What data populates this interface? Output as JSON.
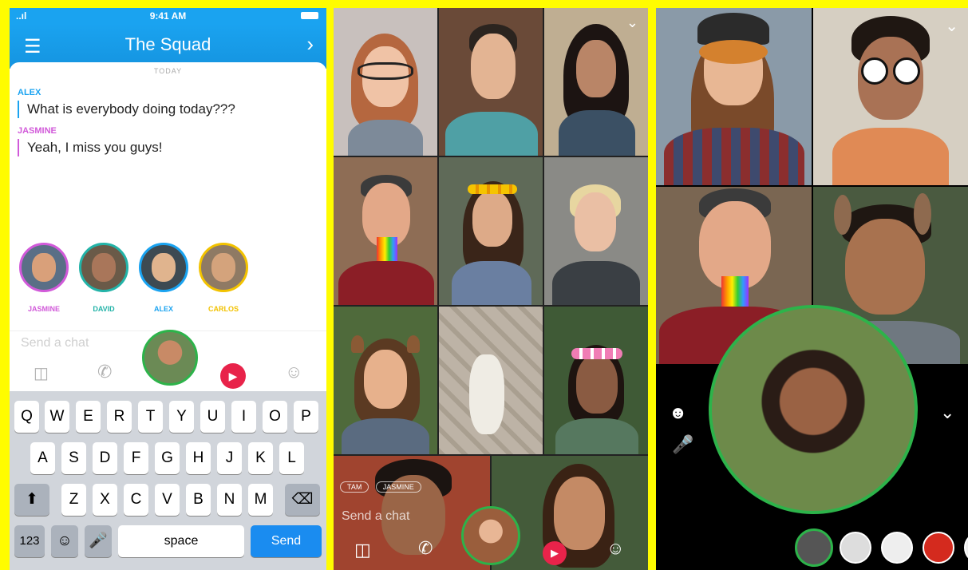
{
  "status_bar": {
    "signal": "..ıl",
    "time": "9:41 AM"
  },
  "chat_header": {
    "title": "The Squad",
    "menu_icon": "hamburger-icon",
    "forward_icon": "chevron-right-icon"
  },
  "chat": {
    "date_label": "TODAY",
    "messages": [
      {
        "author": "ALEX",
        "text": "What is everybody doing today???",
        "color": "#1aa3f0"
      },
      {
        "author": "JASMINE",
        "text": "Yeah, I miss you guys!",
        "color": "#d15ad9"
      }
    ]
  },
  "participants": [
    {
      "name": "JASMINE",
      "color": "#d15ad9"
    },
    {
      "name": "DAVID",
      "color": "#23b3a8"
    },
    {
      "name": "ALEX",
      "color": "#1aa3f0"
    },
    {
      "name": "CARLOS",
      "color": "#f2c200"
    }
  ],
  "composer": {
    "placeholder": "Send a chat"
  },
  "keyboard": {
    "row1": [
      "Q",
      "W",
      "E",
      "R",
      "T",
      "Y",
      "U",
      "I",
      "O",
      "P"
    ],
    "row2": [
      "A",
      "S",
      "D",
      "F",
      "G",
      "H",
      "J",
      "K",
      "L"
    ],
    "row3": [
      "Z",
      "X",
      "C",
      "V",
      "B",
      "N",
      "M"
    ],
    "numbers_key": "123",
    "space_key": "space",
    "send_key": "Send"
  },
  "group_call": {
    "overlay_placeholder": "Send a chat",
    "overlay_tags": [
      "TAM",
      "JASMINE"
    ]
  }
}
